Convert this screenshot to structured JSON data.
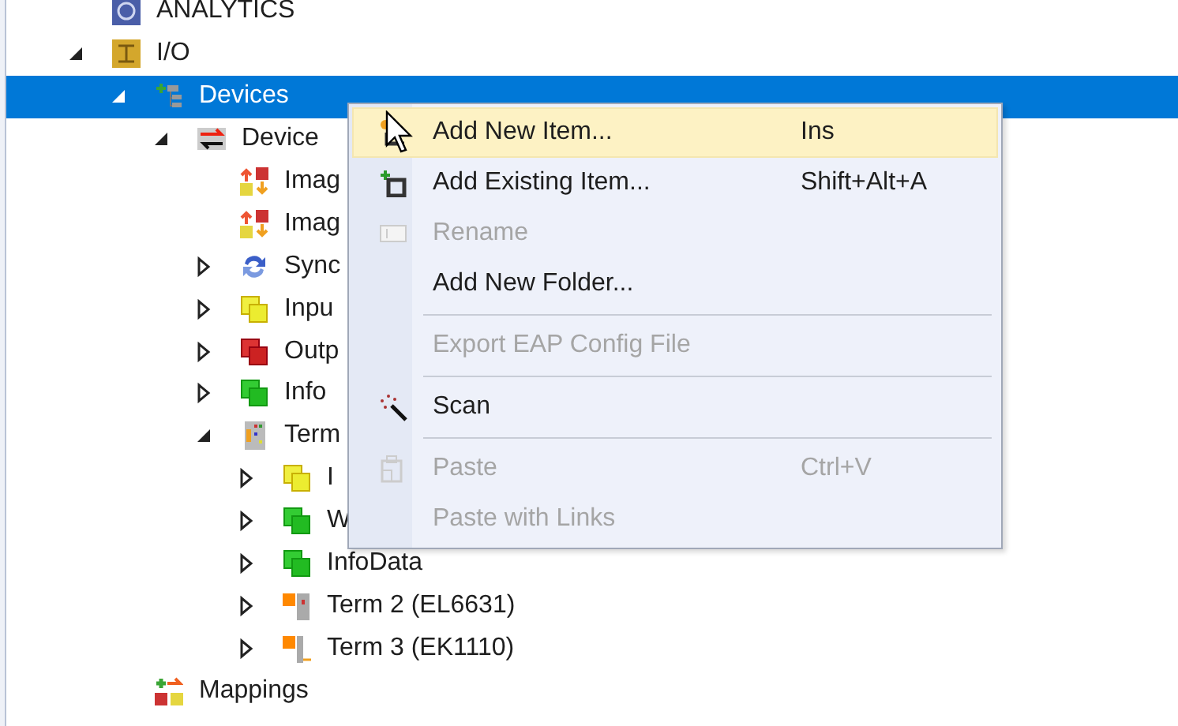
{
  "tree": [
    {
      "label": "ANALYTICS",
      "kind": "analytics",
      "selected": false
    },
    {
      "label": "I/O",
      "kind": "io",
      "expanded": true,
      "selected": false,
      "children": [
        {
          "label": "Devices",
          "kind": "devices",
          "expanded": true,
          "selected": true,
          "children": [
            {
              "label": "Device",
              "kind": "device",
              "expanded": true,
              "selected": false,
              "children": [
                {
                  "label": "Imag",
                  "kind": "image",
                  "selected": false
                },
                {
                  "label": "Imag",
                  "kind": "image",
                  "selected": false
                },
                {
                  "label": "Sync",
                  "kind": "sync",
                  "expanded": false,
                  "selected": false
                },
                {
                  "label": "Inpu",
                  "kind": "input",
                  "expanded": false,
                  "selected": false
                },
                {
                  "label": "Outp",
                  "kind": "output",
                  "expanded": false,
                  "selected": false
                },
                {
                  "label": "Info",
                  "kind": "info",
                  "expanded": false,
                  "selected": false
                },
                {
                  "label": "Term",
                  "kind": "terminal",
                  "expanded": true,
                  "selected": false,
                  "children": [
                    {
                      "label": "I",
                      "kind": "input",
                      "expanded": false,
                      "selected": false
                    },
                    {
                      "label": "W",
                      "kind": "info",
                      "expanded": false,
                      "selected": false
                    },
                    {
                      "label": "InfoData",
                      "kind": "info",
                      "expanded": false,
                      "selected": false
                    },
                    {
                      "label": "Term 2 (EL6631)",
                      "kind": "term-box",
                      "expanded": false,
                      "selected": false
                    },
                    {
                      "label": "Term 3 (EK1110)",
                      "kind": "term-end",
                      "expanded": false,
                      "selected": false
                    }
                  ]
                }
              ]
            }
          ]
        },
        {
          "label": "Mappings",
          "kind": "mappings",
          "selected": false
        }
      ]
    }
  ],
  "context_menu": [
    {
      "kind": "new-item",
      "label": "Add New Item...",
      "shortcut": "Ins",
      "disabled": false,
      "selected": true
    },
    {
      "kind": "existing-item",
      "label": "Add Existing Item...",
      "shortcut": "Shift+Alt+A",
      "disabled": false,
      "selected": false
    },
    {
      "kind": "rename",
      "label": "Rename",
      "disabled": true,
      "selected": false
    },
    {
      "kind": "plain",
      "label": "Add New Folder...",
      "disabled": false,
      "selected": false
    },
    {
      "kind": "separator"
    },
    {
      "kind": "plain",
      "label": "Export EAP Config File",
      "disabled": true,
      "selected": false
    },
    {
      "kind": "separator"
    },
    {
      "kind": "scan",
      "label": "Scan",
      "disabled": false,
      "selected": false
    },
    {
      "kind": "separator"
    },
    {
      "kind": "paste",
      "label": "Paste",
      "shortcut": "Ctrl+V",
      "disabled": true,
      "selected": false
    },
    {
      "kind": "plain",
      "label": "Paste with Links",
      "disabled": true,
      "selected": false
    }
  ]
}
